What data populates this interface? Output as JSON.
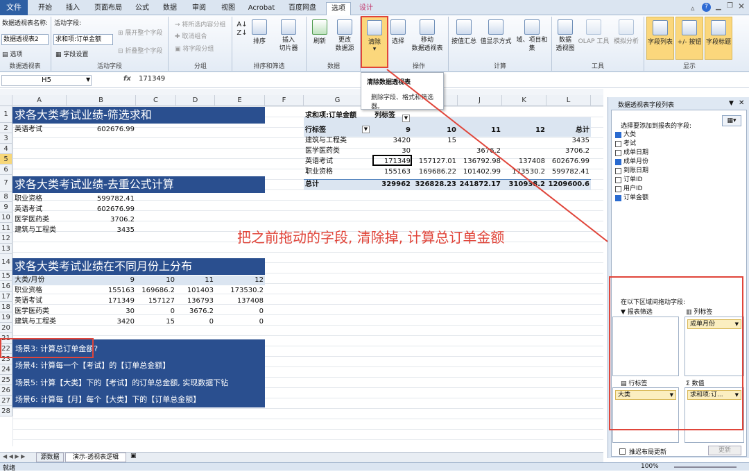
{
  "menu_tabs": [
    "文件",
    "开始",
    "插入",
    "页面布局",
    "公式",
    "数据",
    "审阅",
    "视图",
    "Acrobat",
    "百度网盘",
    "选项",
    "设计"
  ],
  "ribbon": {
    "pivot_name_label": "数据透视表名称:",
    "pivot_name_value": "数据透视表2",
    "options_label": "选项",
    "active_field_label": "活动字段:",
    "active_field_value": "求和项:订单金额",
    "field_settings": "字段设置",
    "expand": "展开整个字段",
    "collapse": "折叠整个字段",
    "group_sel": "将所选内容分组",
    "ungroup": "取消组合",
    "group_field": "将字段分组",
    "sort": "排序",
    "slicer": "插入\n切片器",
    "refresh": "刷新",
    "change_source": "更改\n数据源",
    "clear": "清除",
    "select": "选择",
    "move": "移动\n数据透视表",
    "summarize": "按值汇总",
    "show_as": "值显示方式",
    "fields_items": "域、项目和\n集",
    "pivot_chart": "数据\n透视图",
    "olap": "OLAP 工具",
    "whatif": "模拟分析",
    "field_list": "字段列表",
    "plus_minus": "+/- 按钮",
    "field_headers": "字段标题",
    "groups": [
      "数据透视表",
      "活动字段",
      "分组",
      "排序和筛选",
      "数据",
      "操作",
      "计算",
      "工具",
      "显示"
    ]
  },
  "tooltip": {
    "title": "清除数据透视表",
    "desc": "删除字段、格式和筛选\n器。"
  },
  "formula_bar": {
    "name_box": "H5",
    "fx": "fx",
    "value": "171349"
  },
  "columns": [
    "A",
    "B",
    "C",
    "D",
    "E",
    "F",
    "G",
    "H",
    "I",
    "J",
    "K",
    "L"
  ],
  "rows": [
    "1",
    "2",
    "3",
    "4",
    "5",
    "6",
    "7",
    "8",
    "9",
    "10",
    "11",
    "12",
    "13",
    "14",
    "15",
    "16",
    "17",
    "18",
    "19",
    "20",
    "21",
    "22",
    "23",
    "24",
    "25",
    "26",
    "27",
    "28"
  ],
  "sheet": {
    "banner1": "求各大类考试业绩-筛选求和",
    "r2a": "英语考试",
    "r2b": "602676.99",
    "banner2": "求各大类考试业绩-去重公式计算",
    "list2": [
      [
        "职业资格",
        "599782.41"
      ],
      [
        "英语考试",
        "602676.99"
      ],
      [
        "医学医药类",
        "3706.2"
      ],
      [
        "建筑与工程类",
        "3435"
      ]
    ],
    "banner3": "求各大类考试业绩在不同月份上分布",
    "hdr3": [
      "大类/月份",
      "9",
      "10",
      "11",
      "12"
    ],
    "tbl3": [
      [
        "职业资格",
        "155163",
        "169686.2",
        "101403",
        "173530.2"
      ],
      [
        "英语考试",
        "171349",
        "157127",
        "136793",
        "137408"
      ],
      [
        "医学医药类",
        "30",
        "0",
        "3676.2",
        "0"
      ],
      [
        "建筑与工程类",
        "3420",
        "15",
        "0",
        "0"
      ]
    ],
    "scenes": [
      "场景3:  计算总订单金额?",
      "场景4:  计算每一个【考试】的【订单总金额】",
      "场景5:  计算【大类】下的【考试】的订单总金额, 实现数据下钻",
      "场景6:  计算每【月】每个【大类】下的【订单总金额】"
    ]
  },
  "pivot": {
    "corner": "求和项:订单金额",
    "col_label": "列标签",
    "row_label": "行标签",
    "col_heads": [
      "9",
      "10",
      "11",
      "12",
      "总计"
    ],
    "rows": [
      [
        "建筑与工程类",
        "3420",
        "15",
        "",
        "",
        "3435"
      ],
      [
        "医学医药类",
        "30",
        "",
        "3676.2",
        "",
        "3706.2"
      ],
      [
        "英语考试",
        "171349",
        "157127.01",
        "136792.98",
        "137408",
        "602676.99"
      ],
      [
        "职业资格",
        "155163",
        "169686.22",
        "101402.99",
        "173530.2",
        "599782.41"
      ]
    ],
    "total": [
      "总计",
      "329962",
      "326828.23",
      "241872.17",
      "310938.2",
      "1209600.6"
    ]
  },
  "annotation": "把之前拖动的字段, 清除掉, 计算总订单金额",
  "field_pane": {
    "title": "数据透视表字段列表",
    "choose": "选择要添加到报表的字段:",
    "fields": [
      {
        "name": "大类",
        "checked": true
      },
      {
        "name": "考试",
        "checked": false
      },
      {
        "name": "成单日期",
        "checked": false
      },
      {
        "name": "成单月份",
        "checked": true
      },
      {
        "name": "到账日期",
        "checked": false
      },
      {
        "name": "订单ID",
        "checked": false
      },
      {
        "name": "用户ID",
        "checked": false
      },
      {
        "name": "订单金额",
        "checked": true
      }
    ],
    "drag_label": "在以下区域间拖动字段:",
    "filter": "报表筛选",
    "col_labels": "列标签",
    "row_labels": "行标签",
    "values": "数值",
    "col_chip": "成单月份",
    "row_chip": "大类",
    "val_chip": "求和项:订...",
    "defer": "推迟布局更新",
    "update": "更新"
  },
  "sheet_tabs": [
    "源数据",
    "演示-透视表逻辑"
  ],
  "status": {
    "ready": "就绪",
    "zoom": "100%"
  }
}
